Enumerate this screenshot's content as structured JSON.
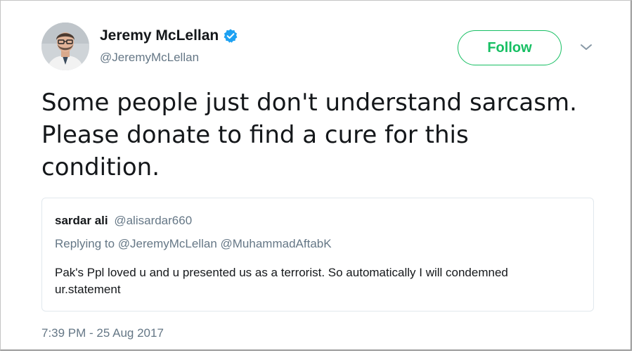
{
  "author": {
    "display_name": "Jeremy McLellan",
    "handle": "@JeremyMcLellan",
    "verified": true,
    "avatar_icon": "user-avatar"
  },
  "follow_button": {
    "label": "Follow",
    "color": "#17bf63"
  },
  "menu_icon": "chevron-down-icon",
  "tweet": {
    "lines": [
      "Some people just don't understand sarcasm.",
      "Please donate to find a cure for this",
      "condition."
    ],
    "timestamp": "7:39 PM - 25 Aug 2017"
  },
  "quoted_tweet": {
    "name": "sardar ali",
    "handle": "@alisardar660",
    "replying_to": "Replying to @JeremyMcLellan @MuhammadAftabK",
    "lines": [
      "Pak's Ppl loved u and u presented us as a terrorist. So automatically I will condemned",
      "ur.statement"
    ]
  },
  "colors": {
    "text_primary": "#14171a",
    "text_secondary": "#657786",
    "verified_badge": "#1da1f2",
    "quote_border": "#e1e8ed"
  }
}
